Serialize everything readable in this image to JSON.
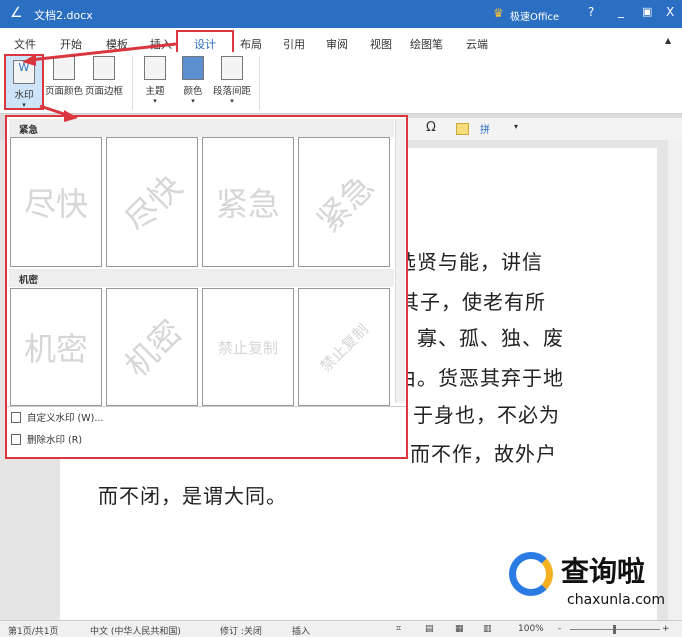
{
  "title": {
    "doc": "文档2.docx",
    "brand": "极速Office",
    "help": "?",
    "minimize": "_",
    "restore": "▣",
    "close": "X"
  },
  "tabs": [
    "文件",
    "开始",
    "模板",
    "插入",
    "设计",
    "布局",
    "引用",
    "审阅",
    "视图",
    "绘图笔",
    "云端"
  ],
  "ribbon": {
    "watermark": "水印",
    "page_color": "页面颜色",
    "page_border": "页面边框",
    "theme": "主题",
    "colors": "颜色",
    "para_spacing": "段落间距"
  },
  "panel": {
    "section1": "紧急",
    "section2": "机密",
    "thumbs1": [
      "尽快",
      "尽快",
      "紧急",
      "紧急"
    ],
    "thumbs2": [
      "机密",
      "机密",
      "禁止复制",
      "禁止复制"
    ],
    "custom": "自定义水印 (W)...",
    "remove": "删除水印 (R)"
  },
  "doc_lines": [
    "选贤与能，讲信",
    "其子，使老有所",
    "寡、孤、独、废",
    "由。货恶其弃于地",
    "于身也，不必为",
    "而不作，故外户",
    "而不闭，是谓大同。"
  ],
  "status": {
    "page": "第1页/共1页",
    "lang": "中文 (中华人民共和国)",
    "track": "修订 :关闭",
    "mode": "插入",
    "zoom": "100%"
  },
  "logo": {
    "name": "查询啦",
    "url": "chaxunla.com"
  }
}
